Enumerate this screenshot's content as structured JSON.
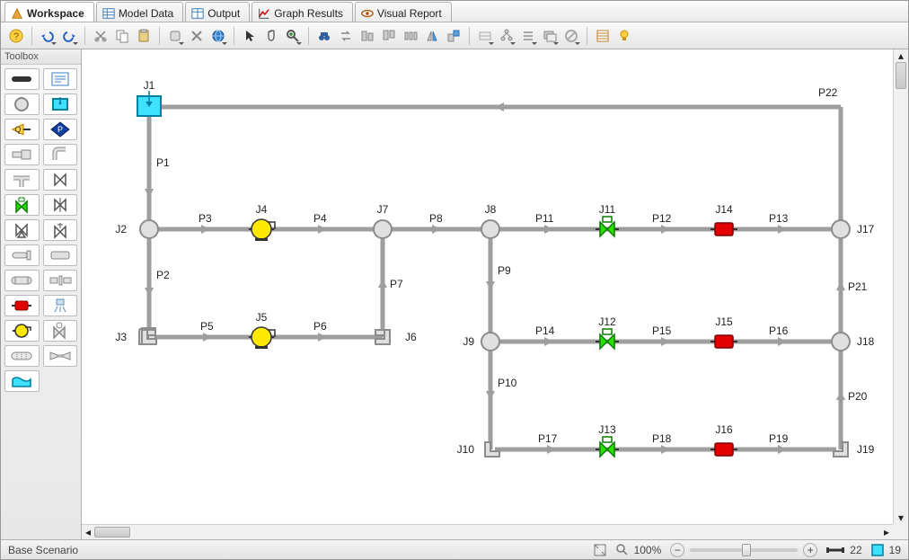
{
  "tabs": [
    {
      "label": "Workspace",
      "active": true
    },
    {
      "label": "Model Data",
      "active": false
    },
    {
      "label": "Output",
      "active": false
    },
    {
      "label": "Graph Results",
      "active": false
    },
    {
      "label": "Visual Report",
      "active": false
    }
  ],
  "toolbox": {
    "title": "Toolbox"
  },
  "status": {
    "scenario": "Base Scenario",
    "zoom": "100%",
    "pipe_count": "22",
    "junction_count": "19"
  },
  "junctions": {
    "J1": "J1",
    "J2": "J2",
    "J3": "J3",
    "J4": "J4",
    "J5": "J5",
    "J6": "J6",
    "J7": "J7",
    "J8": "J8",
    "J9": "J9",
    "J10": "J10",
    "J11": "J11",
    "J12": "J12",
    "J13": "J13",
    "J14": "J14",
    "J15": "J15",
    "J16": "J16",
    "J17": "J17",
    "J18": "J18",
    "J19": "J19"
  },
  "pipes": {
    "P1": "P1",
    "P2": "P2",
    "P3": "P3",
    "P4": "P4",
    "P5": "P5",
    "P6": "P6",
    "P7": "P7",
    "P8": "P8",
    "P9": "P9",
    "P10": "P10",
    "P11": "P11",
    "P12": "P12",
    "P13": "P13",
    "P14": "P14",
    "P15": "P15",
    "P16": "P16",
    "P17": "P17",
    "P18": "P18",
    "P19": "P19",
    "P20": "P20",
    "P21": "P21",
    "P22": "P22"
  }
}
